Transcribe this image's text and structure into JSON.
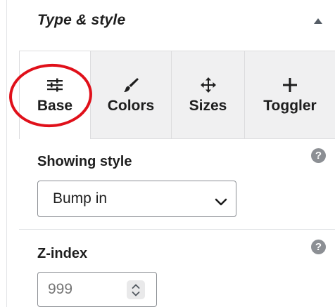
{
  "panel": {
    "title": "Type & style",
    "collapse_icon": "chevron-up-icon"
  },
  "tabs": [
    {
      "label": "Base",
      "icon": "sliders-icon",
      "active": true
    },
    {
      "label": "Colors",
      "icon": "paintbrush-icon",
      "active": false
    },
    {
      "label": "Sizes",
      "icon": "move-arrows-icon",
      "active": false
    },
    {
      "label": "Toggler",
      "icon": "plus-icon",
      "active": false
    }
  ],
  "showing_style": {
    "label": "Showing style",
    "value": "Bump in",
    "help": "?"
  },
  "z_index": {
    "label": "Z-index",
    "value": "999",
    "help": "?"
  },
  "colors": {
    "annotation": "#e0101a",
    "tab_inactive": "#f0f0f1",
    "help_icon": "#8c8f94"
  }
}
